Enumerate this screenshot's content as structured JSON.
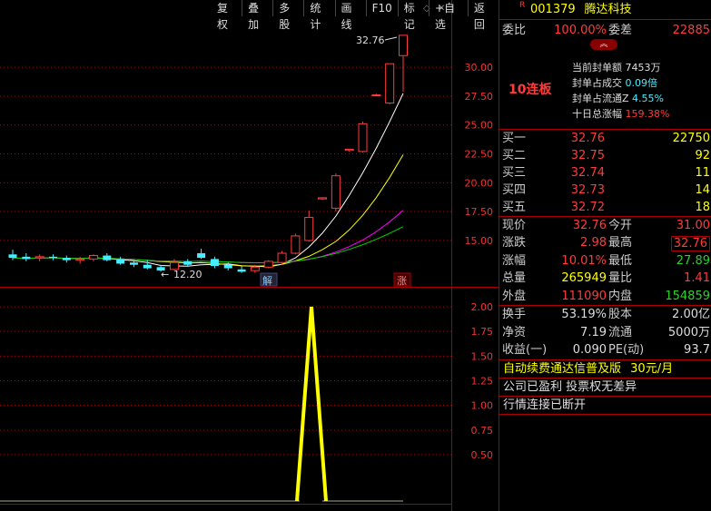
{
  "toolbar": {
    "items": [
      "复权",
      "叠加",
      "多股",
      "统计",
      "画线",
      "F10",
      "标记",
      "+自选",
      "返回"
    ]
  },
  "stock": {
    "badge": "R",
    "code": "001379",
    "name": "腾达科技"
  },
  "weibi": {
    "label1": "委比",
    "value1": "100.00%",
    "label2": "委差",
    "value2": "22885"
  },
  "seal": {
    "title": "10连板",
    "lines": [
      {
        "label": "当前封单额",
        "value": "7453万"
      },
      {
        "label": "封单占成交",
        "value": "0.09倍"
      },
      {
        "label": "封单占流通Z",
        "value": "4.55%"
      },
      {
        "label": "十日总涨幅",
        "value": "159.38%"
      }
    ]
  },
  "bids": [
    {
      "label": "买一",
      "price": "32.76",
      "vol": "22750"
    },
    {
      "label": "买二",
      "price": "32.75",
      "vol": "92"
    },
    {
      "label": "买三",
      "price": "32.74",
      "vol": "11"
    },
    {
      "label": "买四",
      "price": "32.73",
      "vol": "14"
    },
    {
      "label": "买五",
      "price": "32.72",
      "vol": "18"
    }
  ],
  "quote": [
    {
      "l1": "现价",
      "v1": "32.76",
      "c1": "red",
      "l2": "今开",
      "v2": "31.00",
      "c2": "red"
    },
    {
      "l1": "涨跌",
      "v1": "2.98",
      "c1": "red",
      "l2": "最高",
      "v2": "32.76",
      "c2": "red"
    },
    {
      "l1": "涨幅",
      "v1": "10.01%",
      "c1": "red",
      "l2": "最低",
      "v2": "27.89",
      "c2": "green"
    },
    {
      "l1": "总量",
      "v1": "265949",
      "c1": "yellow",
      "l2": "量比",
      "v2": "1.41",
      "c2": "red"
    },
    {
      "l1": "外盘",
      "v1": "111090",
      "c1": "red",
      "l2": "内盘",
      "v2": "154859",
      "c2": "green"
    }
  ],
  "fund": [
    {
      "l1": "换手",
      "v1": "53.19%",
      "l2": "股本",
      "v2": "2.00亿"
    },
    {
      "l1": "净资",
      "v1": "7.19",
      "l2": "流通",
      "v2": "5000万"
    },
    {
      "l1": "收益(一)",
      "v1": "0.090",
      "l2": "PE(动)",
      "v2": "93.7"
    }
  ],
  "ads": {
    "line1": "自动续费通达信普及版",
    "price": "30元/月",
    "line2": "公司已盈利 投票权无差异",
    "line3": "行情连接已断开"
  },
  "chart": {
    "yaxis": [
      "30.00",
      "27.50",
      "25.00",
      "22.50",
      "20.00",
      "17.50",
      "15.00"
    ],
    "high_label": "32.76",
    "low_label": "12.20",
    "tag_jie": "解",
    "tag_zhang": "涨",
    "ind_axis": [
      "2.00",
      "1.75",
      "1.50",
      "1.25",
      "1.00",
      "0.75",
      "0.50"
    ]
  },
  "chart_data": {
    "type": "candlestick",
    "price_axis": [
      15.0,
      30.0
    ],
    "candles": [
      {
        "o": 13.8,
        "h": 14.2,
        "l": 13.3,
        "c": 13.5
      },
      {
        "o": 13.6,
        "h": 13.9,
        "l": 13.2,
        "c": 13.4
      },
      {
        "o": 13.5,
        "h": 13.8,
        "l": 13.2,
        "c": 13.6
      },
      {
        "o": 13.6,
        "h": 13.8,
        "l": 13.3,
        "c": 13.5
      },
      {
        "o": 13.5,
        "h": 13.7,
        "l": 13.1,
        "c": 13.3
      },
      {
        "o": 13.3,
        "h": 13.6,
        "l": 13.0,
        "c": 13.4
      },
      {
        "o": 13.4,
        "h": 13.8,
        "l": 13.2,
        "c": 13.7
      },
      {
        "o": 13.7,
        "h": 13.9,
        "l": 13.2,
        "c": 13.3
      },
      {
        "o": 13.4,
        "h": 13.6,
        "l": 12.9,
        "c": 13.0
      },
      {
        "o": 13.1,
        "h": 13.3,
        "l": 12.7,
        "c": 12.9
      },
      {
        "o": 12.9,
        "h": 13.3,
        "l": 12.5,
        "c": 12.6
      },
      {
        "o": 12.7,
        "h": 12.9,
        "l": 12.3,
        "c": 12.4
      },
      {
        "o": 12.5,
        "h": 13.4,
        "l": 12.4,
        "c": 13.1
      },
      {
        "o": 13.2,
        "h": 13.4,
        "l": 12.8,
        "c": 12.9
      },
      {
        "o": 13.9,
        "h": 14.3,
        "l": 13.4,
        "c": 13.5
      },
      {
        "o": 13.4,
        "h": 13.6,
        "l": 12.6,
        "c": 12.8
      },
      {
        "o": 12.9,
        "h": 13.1,
        "l": 12.4,
        "c": 12.6
      },
      {
        "o": 12.5,
        "h": 12.8,
        "l": 12.2,
        "c": 12.3
      },
      {
        "o": 12.4,
        "h": 12.9,
        "l": 12.2,
        "c": 12.7
      },
      {
        "o": 12.7,
        "h": 13.3,
        "l": 12.6,
        "c": 13.2
      },
      {
        "o": 13.1,
        "h": 14.1,
        "l": 12.9,
        "c": 13.9
      },
      {
        "o": 13.9,
        "h": 15.6,
        "l": 13.8,
        "c": 15.4
      },
      {
        "o": 15.0,
        "h": 17.6,
        "l": 14.9,
        "c": 17.0
      },
      {
        "o": 18.6,
        "h": 18.7,
        "l": 18.5,
        "c": 18.7
      },
      {
        "o": 17.8,
        "h": 20.8,
        "l": 17.5,
        "c": 20.6
      },
      {
        "o": 22.8,
        "h": 22.9,
        "l": 22.7,
        "c": 22.9
      },
      {
        "o": 22.7,
        "h": 25.3,
        "l": 22.6,
        "c": 25.1
      },
      {
        "o": 27.6,
        "h": 27.7,
        "l": 27.5,
        "c": 27.6
      },
      {
        "o": 26.9,
        "h": 30.3,
        "l": 26.8,
        "c": 30.3
      },
      {
        "o": 31.0,
        "h": 32.76,
        "l": 27.89,
        "c": 32.76
      }
    ],
    "indicator": {
      "range": [
        0.5,
        2.0
      ],
      "spike_value": 2.0
    }
  }
}
